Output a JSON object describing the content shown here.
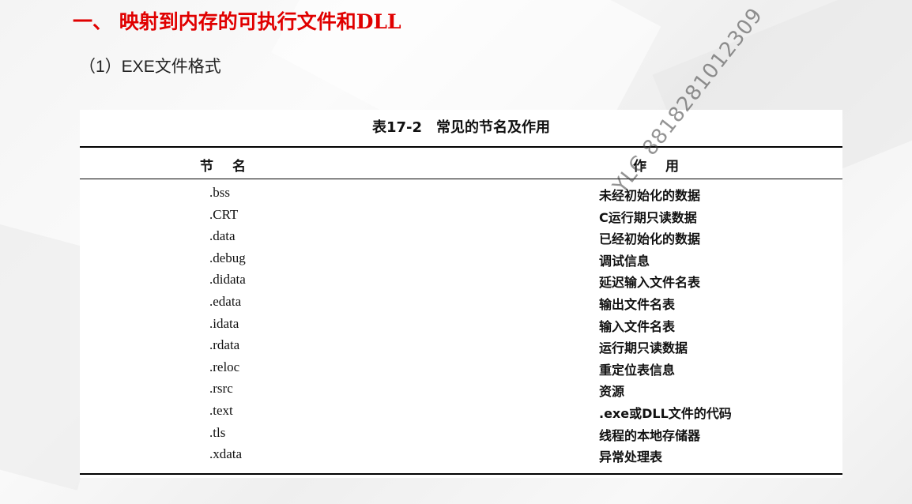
{
  "slide": {
    "title": "一、 映射到内存的可执行文件和DLL",
    "subtitle": "（1）EXE文件格式"
  },
  "table": {
    "caption": "表17-2　常见的节名及作用",
    "headers": {
      "name": "节名",
      "use": "作用"
    },
    "rows": [
      {
        "name": ".bss",
        "use": "未经初始化的数据"
      },
      {
        "name": ".CRT",
        "use": "C运行期只读数据"
      },
      {
        "name": ".data",
        "use": "已经初始化的数据"
      },
      {
        "name": ".debug",
        "use": "调试信息"
      },
      {
        "name": ".didata",
        "use": "延迟输入文件名表"
      },
      {
        "name": ".edata",
        "use": "输出文件名表"
      },
      {
        "name": ".idata",
        "use": "输入文件名表"
      },
      {
        "name": ".rdata",
        "use": "运行期只读数据"
      },
      {
        "name": ".reloc",
        "use": "重定位表信息"
      },
      {
        "name": ".rsrc",
        "use": "资源"
      },
      {
        "name": ".text",
        "use": ".exe或DLL文件的代码"
      },
      {
        "name": ".tls",
        "use": "线程的本地存储器"
      },
      {
        "name": ".xdata",
        "use": "异常处理表"
      }
    ]
  },
  "watermark": "YLC 8818281012309",
  "colors": {
    "title": "#e00000",
    "text": "#111111"
  }
}
